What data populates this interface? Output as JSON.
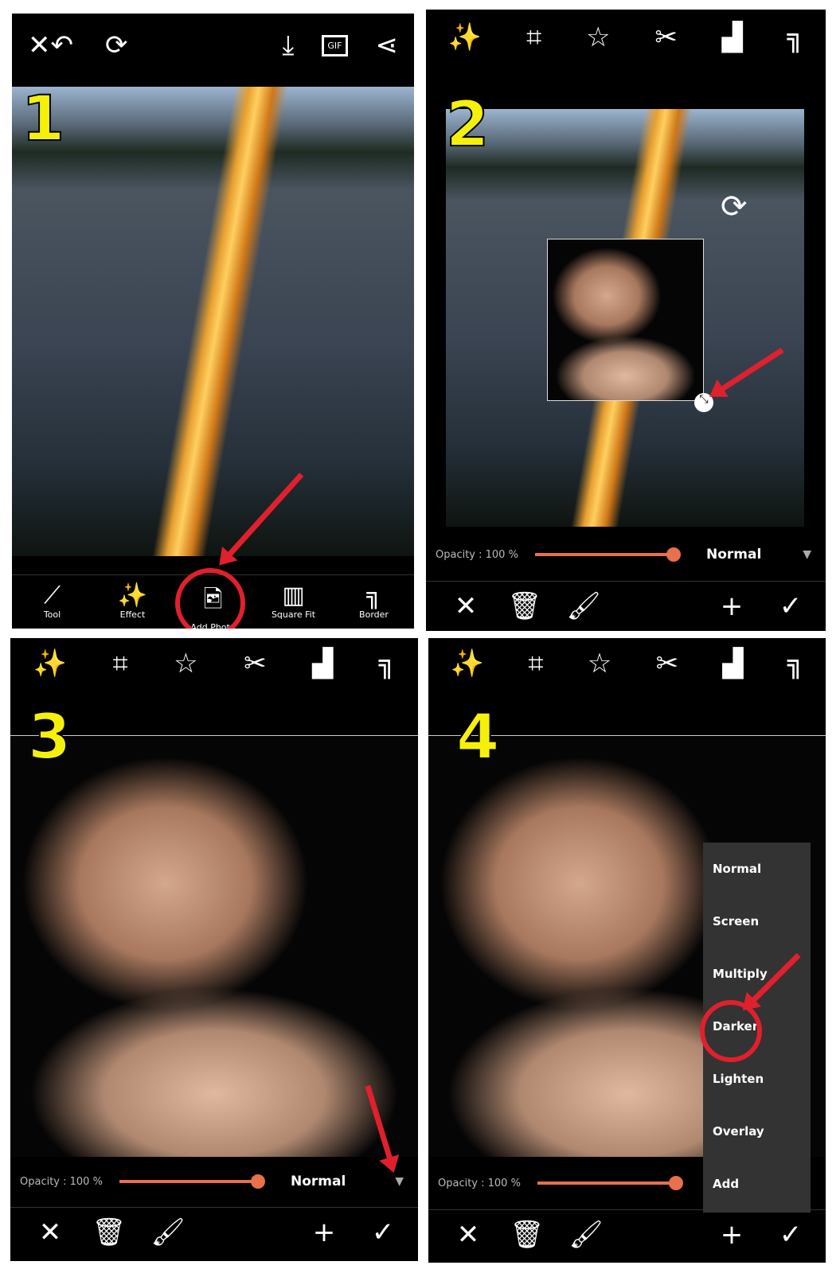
{
  "steps": [
    "1",
    "2",
    "3",
    "4"
  ],
  "panel1": {
    "top_icons": [
      "close-icon",
      "undo-icon",
      "rotate-icon",
      "download-icon",
      "gif-icon",
      "share-icon"
    ],
    "gif_label": "GIF",
    "tools": [
      {
        "label": "Tool",
        "icon": "compass-icon"
      },
      {
        "label": "Effect",
        "icon": "magic-wand-icon"
      },
      {
        "label": "Add Photo",
        "icon": "add-photo-icon"
      },
      {
        "label": "Square Fit",
        "icon": "square-fit-icon"
      },
      {
        "label": "Border",
        "icon": "border-icon"
      }
    ]
  },
  "editor_toolbar": [
    "magic-wand-icon",
    "crop-icon",
    "star-icon",
    "scissors-icon",
    "sticker-icon",
    "border-icon"
  ],
  "opacity": {
    "label": "Opacity : 100 %",
    "value": 100
  },
  "blend_mode": "Normal",
  "blend_menu": [
    "Normal",
    "Screen",
    "Multiply",
    "Darken",
    "Lighten",
    "Overlay",
    "Add"
  ],
  "highlighted_mode": "Darken",
  "bottom_actions": [
    "close-icon",
    "trash-icon",
    "brush-icon",
    "plus-icon",
    "check-icon"
  ],
  "accent": "#e8704a",
  "highlight": "#e0202c",
  "step_color": "#f5f00a"
}
